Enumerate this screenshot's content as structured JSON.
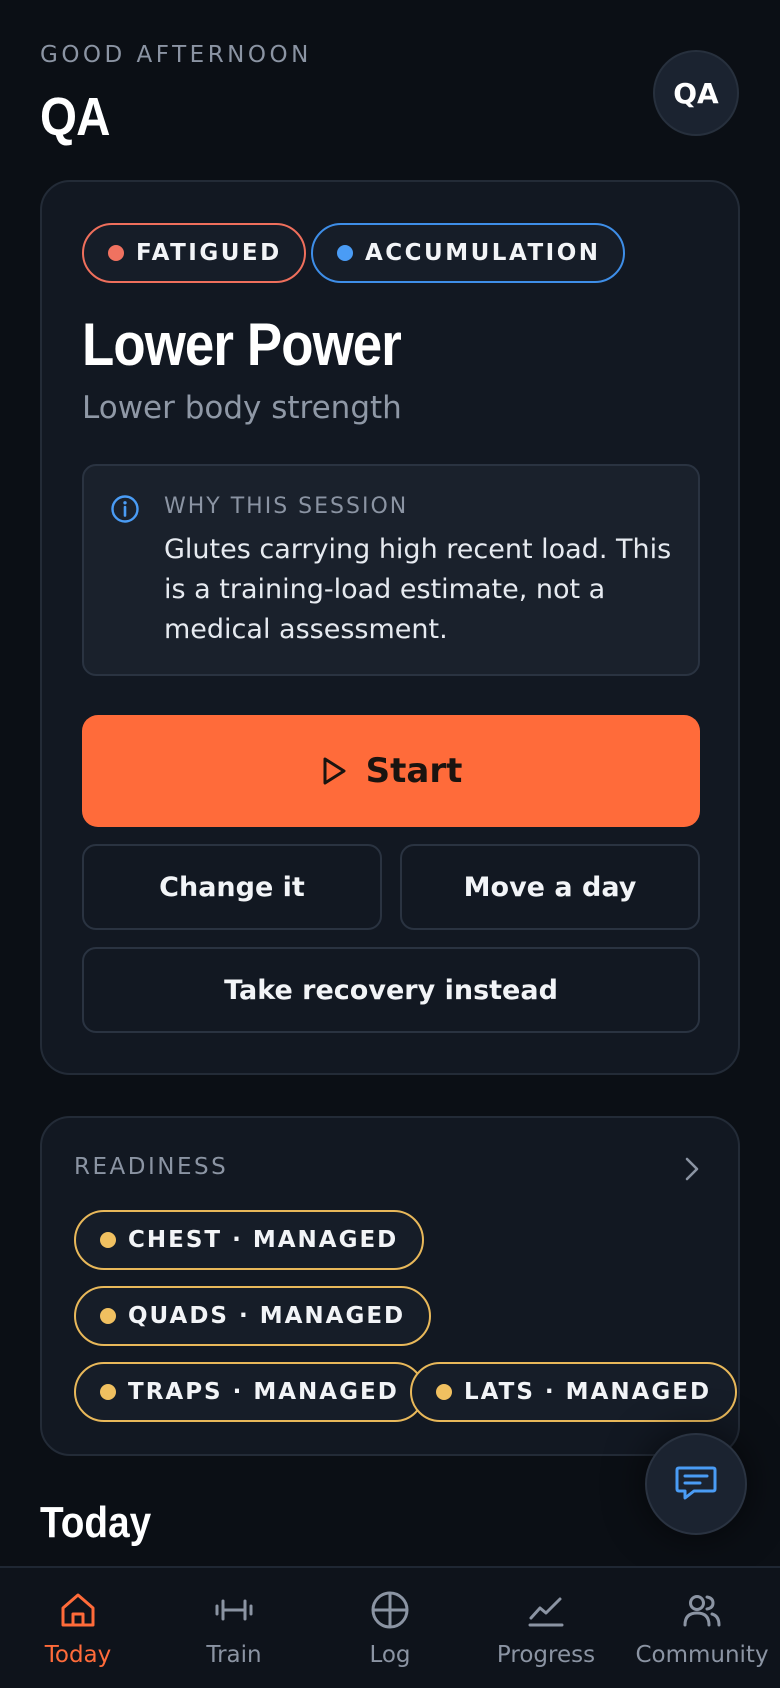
{
  "header": {
    "greeting": "GOOD AFTERNOON",
    "user_name": "QA",
    "avatar_initials": "QA"
  },
  "session": {
    "status_badges": [
      {
        "label": "FATIGUED",
        "color": "#f07260"
      },
      {
        "label": "ACCUMULATION",
        "color": "#4a9cf5"
      }
    ],
    "title": "Lower Power",
    "subtitle": "Lower body strength",
    "why": {
      "icon": "info-icon",
      "heading": "WHY THIS SESSION",
      "text": "Glutes carrying high recent load. This is a training-load estimate, not a medical assessment."
    },
    "start_label": "Start",
    "change_label": "Change it",
    "move_label": "Move a day",
    "recovery_label": "Take recovery instead"
  },
  "readiness": {
    "label": "READINESS",
    "muscles": [
      {
        "label": "CHEST · MANAGED",
        "color": "#f0c060"
      },
      {
        "label": "QUADS · MANAGED",
        "color": "#f0c060"
      },
      {
        "label": "TRAPS · MANAGED",
        "color": "#f0c060"
      },
      {
        "label": "LATS · MANAGED",
        "color": "#f0c060"
      }
    ]
  },
  "today_heading": "Today",
  "chat_button": {
    "icon": "chat-icon"
  },
  "bottom_nav": {
    "items": [
      {
        "label": "Today",
        "icon": "home-icon",
        "active": true
      },
      {
        "label": "Train",
        "icon": "dumbbell-icon",
        "active": false
      },
      {
        "label": "Log",
        "icon": "plus-circle-icon",
        "active": false
      },
      {
        "label": "Progress",
        "icon": "trend-chart-icon",
        "active": false
      },
      {
        "label": "Community",
        "icon": "users-icon",
        "active": false
      }
    ]
  },
  "colors": {
    "accent": "#ff6b3a",
    "background": "#0b0f15",
    "card": "#121822",
    "managed": "#e8b85a"
  }
}
